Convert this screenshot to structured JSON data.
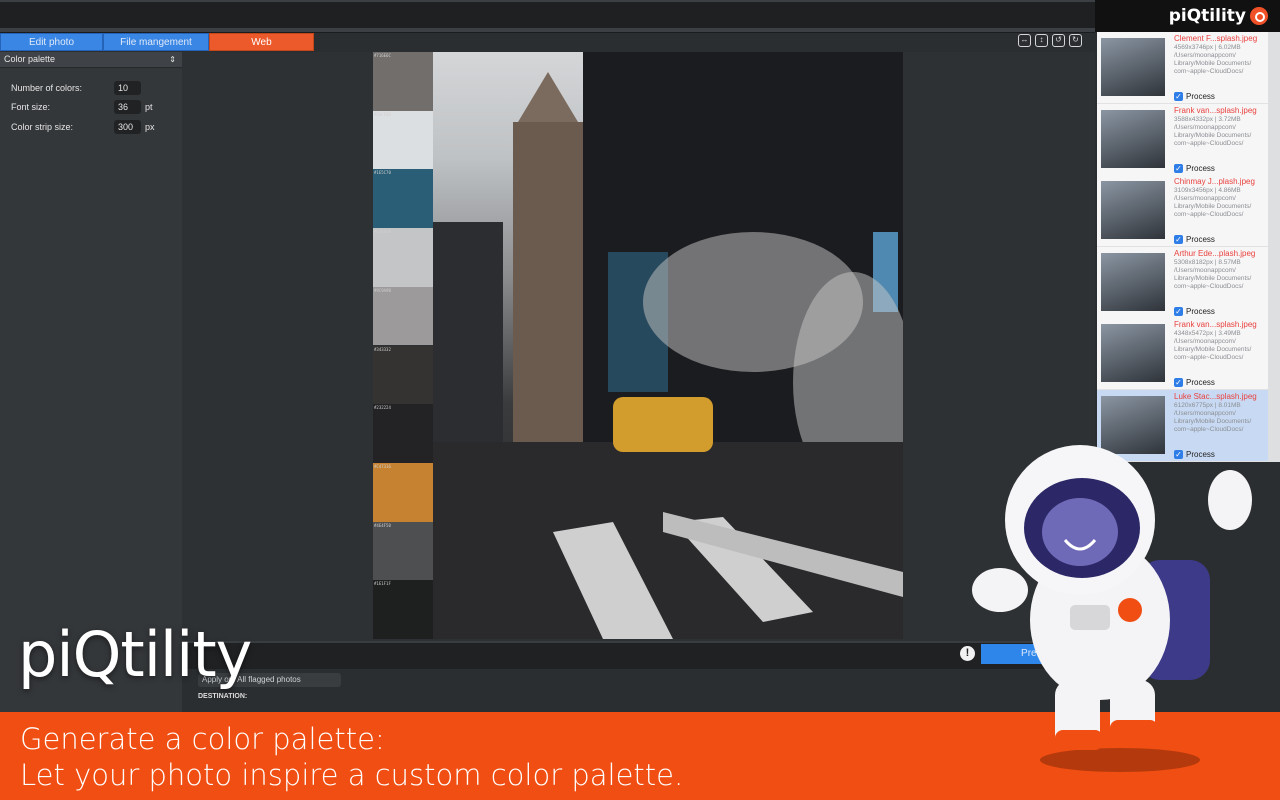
{
  "brand": {
    "name": "piQtility",
    "logo_icon": "magnifier-logo-icon"
  },
  "tabs": [
    {
      "label": "Edit photo"
    },
    {
      "label": "File mangement"
    },
    {
      "label": "Web"
    }
  ],
  "sidebar": {
    "mode": "Color palette",
    "fields": [
      {
        "label": "Number of colors:",
        "value": "10",
        "unit": ""
      },
      {
        "label": "Font size:",
        "value": "36",
        "unit": "pt"
      },
      {
        "label": "Color strip size:",
        "value": "300",
        "unit": "px"
      }
    ]
  },
  "palette": [
    {
      "code": "#716E6C",
      "color": "#716e6c"
    },
    {
      "code": "#CDCFD8",
      "color": "#dcdfe2"
    },
    {
      "code": "#1E5C70",
      "color": "#2a5e76"
    },
    {
      "code": "#C4C6C8",
      "color": "#c3c5c7"
    },
    {
      "code": "#9C9A9B",
      "color": "#9c9a9b"
    },
    {
      "code": "#343332",
      "color": "#343332"
    },
    {
      "code": "#232224",
      "color": "#232224"
    },
    {
      "code": "#C47316",
      "color": "#c68231"
    },
    {
      "code": "#4E4F50",
      "color": "#4e4f50"
    },
    {
      "code": "#1E1F1F",
      "color": "#1e1f1f"
    }
  ],
  "bottom": {
    "presets_label": "Presets",
    "apply_label": "Apply on: All flagged photos",
    "destination_label": "DESTINATION:"
  },
  "files": [
    {
      "name": "Clement F...splash.jpeg",
      "meta": "4569x3746px | 6.02MB",
      "path1": "/Users/moonappcom/",
      "path2": "Library/Mobile Documents/",
      "path3": "com~apple~CloudDocs/",
      "process": "Process",
      "selected": false
    },
    {
      "name": "Frank van...splash.jpeg",
      "meta": "3588x4332px | 3.72MB",
      "path1": "/Users/moonappcom/",
      "path2": "Library/Mobile Documents/",
      "path3": "com~apple~CloudDocs/",
      "process": "Process",
      "selected": false
    },
    {
      "name": "Chinmay J...plash.jpeg",
      "meta": "3109x3456px | 4.86MB",
      "path1": "/Users/moonappcom/",
      "path2": "Library/Mobile Documents/",
      "path3": "com~apple~CloudDocs/",
      "process": "Process",
      "selected": false
    },
    {
      "name": "Arthur Ede...plash.jpeg",
      "meta": "5308x8182px | 8.57MB",
      "path1": "/Users/moonappcom/",
      "path2": "Library/Mobile Documents/",
      "path3": "com~apple~CloudDocs/",
      "process": "Process",
      "selected": false
    },
    {
      "name": "Frank van...splash.jpeg",
      "meta": "4348x5472px | 3.49MB",
      "path1": "/Users/moonappcom/",
      "path2": "Library/Mobile Documents/",
      "path3": "com~apple~CloudDocs/",
      "process": "Process",
      "selected": false
    },
    {
      "name": "Luke Stac...splash.jpeg",
      "meta": "6120x6775px | 8.01MB",
      "path1": "/Users/moonappcom/",
      "path2": "Library/Mobile Documents/",
      "path3": "com~apple~CloudDocs/",
      "process": "Process",
      "selected": true
    }
  ],
  "overlay": {
    "title": "piQtility",
    "headline_1": "Generate a color palette:",
    "headline_2": "Let your photo inspire a custom color palette."
  },
  "colors": {
    "accent_blue": "#3a86e5",
    "accent_orange": "#f04e12"
  }
}
